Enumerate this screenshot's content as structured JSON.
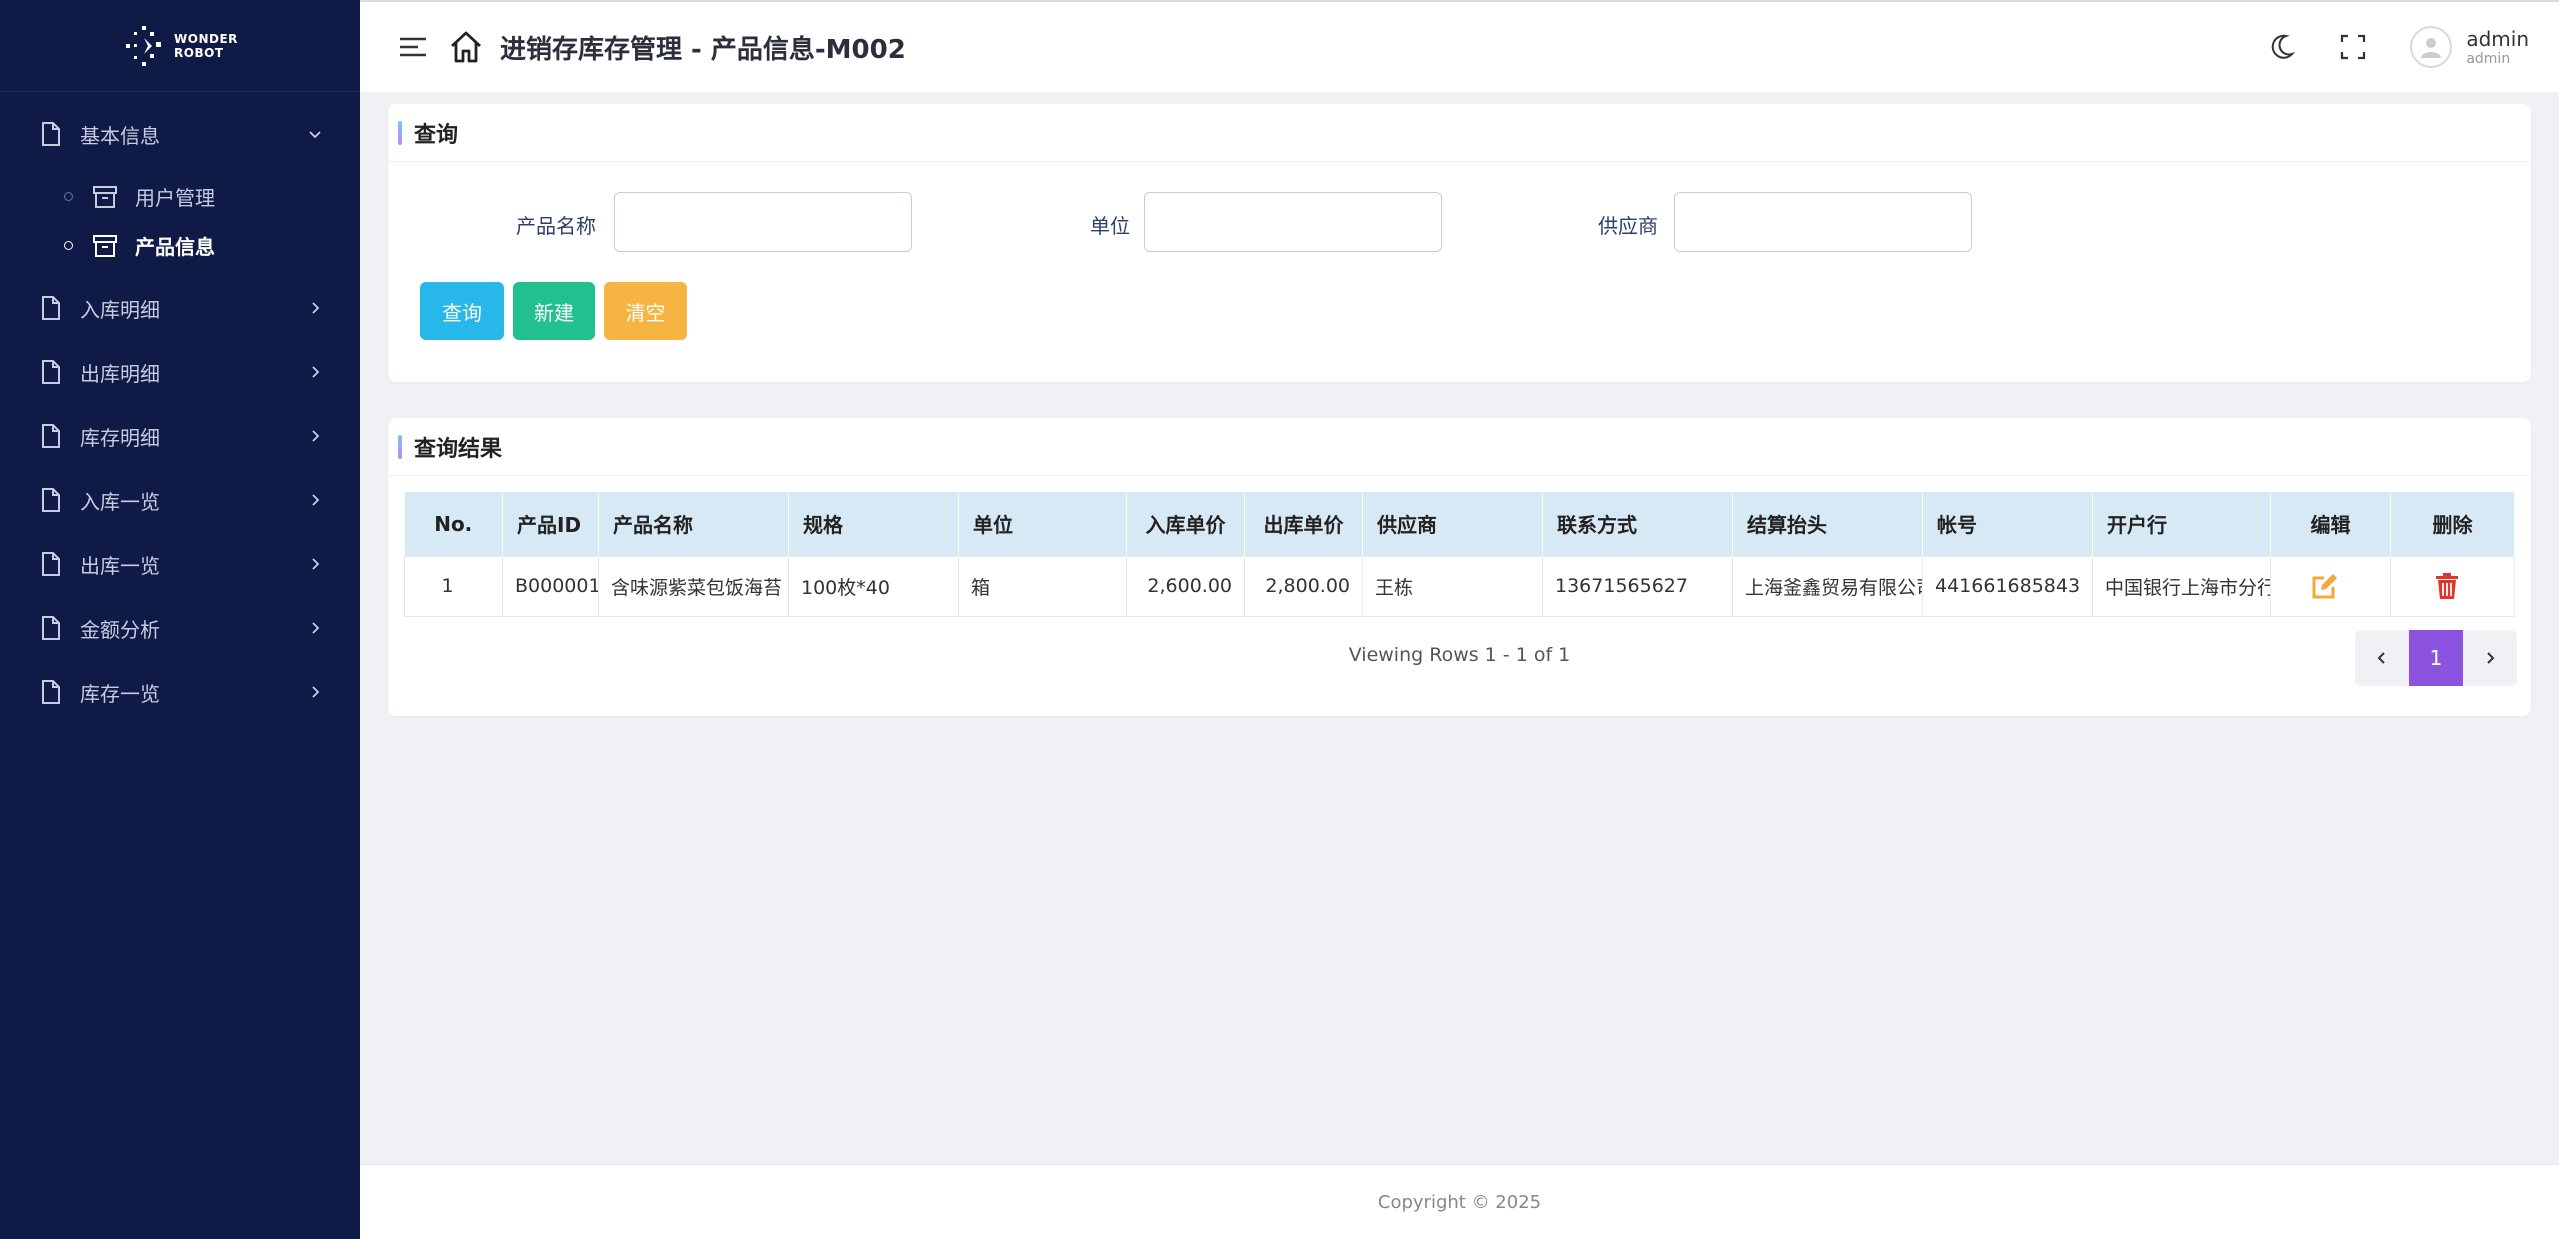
{
  "logo": {
    "line1": "WONDER",
    "line2": "ROBOT"
  },
  "sidebar": {
    "items": [
      {
        "label": "基本信息",
        "open": true
      },
      {
        "label": "入库明细"
      },
      {
        "label": "出库明细"
      },
      {
        "label": "库存明细"
      },
      {
        "label": "入库一览"
      },
      {
        "label": "出库一览"
      },
      {
        "label": "金额分析"
      },
      {
        "label": "库存一览"
      }
    ],
    "subitems": [
      {
        "label": "用户管理"
      },
      {
        "label": "产品信息",
        "active": true
      }
    ]
  },
  "header": {
    "title": "进销存库存管理 - 产品信息-M002",
    "user_name": "admin",
    "user_role": "admin"
  },
  "search": {
    "title": "查询",
    "fields": [
      {
        "label": "产品名称",
        "value": ""
      },
      {
        "label": "单位",
        "value": ""
      },
      {
        "label": "供应商",
        "value": ""
      }
    ],
    "buttons": {
      "query": "查询",
      "new": "新建",
      "clear": "清空"
    }
  },
  "results": {
    "title": "查询结果",
    "columns": [
      "No.",
      "产品ID",
      "产品名称",
      "规格",
      "单位",
      "入库单价",
      "出库单价",
      "供应商",
      "联系方式",
      "结算抬头",
      "帐号",
      "开户行",
      "编辑",
      "删除"
    ],
    "rows": [
      {
        "no": "1",
        "id": "B000001",
        "name": "含味源紫菜包饭海苔",
        "spec": "100枚*40",
        "unit": "箱",
        "in_price": "2,600.00",
        "out_price": "2,800.00",
        "supplier": "王栋",
        "contact": "13671565627",
        "billing": "上海釜鑫贸易有限公司",
        "account": "441661685843",
        "bank": "中国银行上海市分行"
      }
    ],
    "viewing": "Viewing Rows 1 - 1 of 1",
    "current_page": "1"
  },
  "footer": {
    "copyright": "Copyright © 2025"
  },
  "colors": {
    "sidebar_bg": "#101a47",
    "query_btn": "#27b7e8",
    "new_btn": "#23c08f",
    "clear_btn": "#f6b443",
    "page_active": "#8c52e0",
    "edit_icon": "#f2a93b",
    "delete_icon": "#e0352b"
  }
}
